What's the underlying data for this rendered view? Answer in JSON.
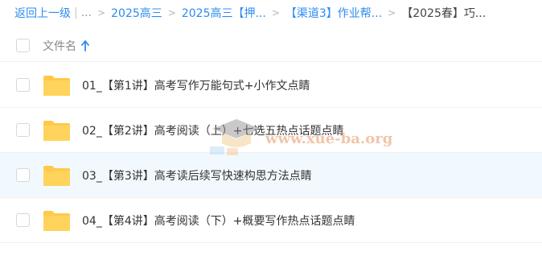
{
  "breadcrumb": {
    "back": "返回上一级",
    "ellipsis": "...",
    "items": [
      "2025高三",
      "2025高三【押...",
      "【渠道3】作业帮..."
    ],
    "current": "【2025春】巧..."
  },
  "header": {
    "column_label": "文件名"
  },
  "files": [
    {
      "name": "01_【第1讲】高考写作万能句式+小作文点睛"
    },
    {
      "name": "02_【第2讲】高考阅读（上）+七选五热点话题点睛"
    },
    {
      "name": "03_【第3讲】高考读后续写快速构思方法点睛"
    },
    {
      "name": "04_【第4讲】高考阅读（下）+概要写作热点话题点睛"
    }
  ],
  "watermark": {
    "text": "www.xue-ba.org"
  },
  "colors": {
    "link": "#2d8cf0",
    "folder": "#ffc94a",
    "row_highlight": "#f2f9fe"
  }
}
